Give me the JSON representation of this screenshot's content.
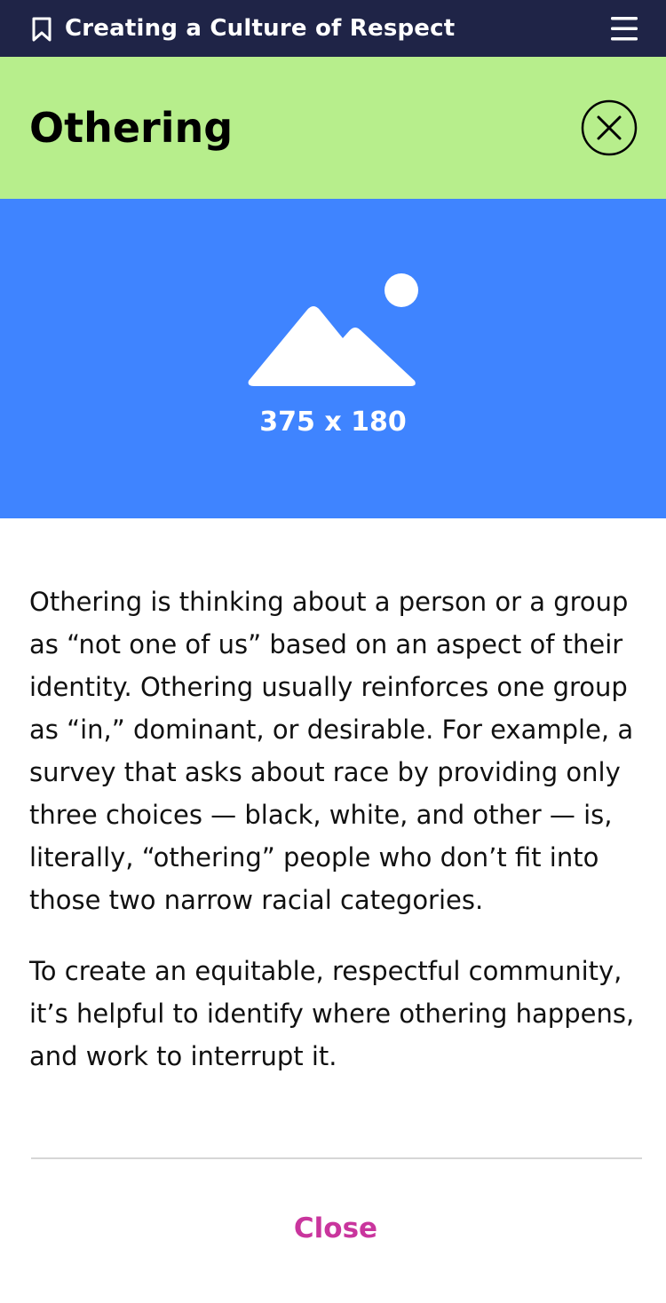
{
  "topbar": {
    "title": "Creating a Culture of Respect",
    "bookmark_icon": "bookmark-icon",
    "menu_icon": "hamburger-menu-icon"
  },
  "header": {
    "title": "Othering",
    "close_icon": "close-circle-icon",
    "background_color": "#b7ee8c"
  },
  "hero": {
    "image_icon": "image-placeholder-icon",
    "dimensions_label": "375 x 180",
    "background_color": "#3f84ff"
  },
  "content": {
    "paragraphs": [
      "Othering is thinking about a person or a group as “not one of us” based on an aspect of their identity. Othering usually reinforces one group as “in,” dominant, or desirable. For example, a survey that asks about race by providing only three choices — black, white, and other — is, literally, “othering” people who don’t fit into those two narrow racial categories.",
      "To create an equitable, respectful community, it’s helpful to identify where othering happens, and work to interrupt it."
    ]
  },
  "footer": {
    "close_label": "Close",
    "close_color": "#c9359d"
  },
  "colors": {
    "topbar": "#1f2447",
    "text": "#111111"
  }
}
